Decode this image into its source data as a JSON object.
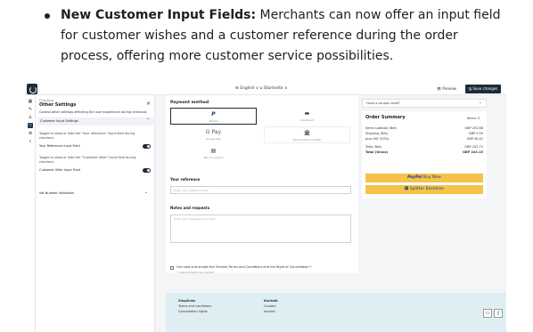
{
  "bullet": {
    "bold": "New Customer Input Fields:",
    "text": " Merchants can now offer an input field for customer wishes and a customer reference during the order process, offering more customer service possibilities."
  },
  "topbar": {
    "language": "⊕ English ∨  ⌂ Startseite ∨",
    "preview": "👁 Preview",
    "save": "🖫 Save changes"
  },
  "sidebar": {
    "small_label": "Checkout",
    "title": "Other Settings",
    "description": "Control other settings affecting the user experience during checkout.",
    "accordion_label": "Customer Input Settings",
    "toggle1_desc": "Toggle to show or hide the \"Your reference\" input field during checkout.",
    "toggle1_label": "Your Reference Input Field",
    "toggle2_desc": "Toggle to show or hide the \"Customer Wish\" input field during checkout.",
    "toggle2_label": "Customer Wish Input Field",
    "vat_label": "Vat Number Validation"
  },
  "form": {
    "payment_title": "Payment method",
    "methods": [
      {
        "name": "PayPal",
        "label": "Paypal"
      },
      {
        "name": "Card",
        "label": "Creditcard"
      },
      {
        "name": "G Pay",
        "label": "Google Pay"
      },
      {
        "name": "Bank",
        "label": "Special bank transfer"
      },
      {
        "name": "Invoice",
        "label": "Pay on invoice"
      }
    ],
    "reference_label": "Your reference",
    "reference_placeholder": "Enter your reference here",
    "notes_label": "Notes and requests",
    "notes_placeholder": "Enter your message to us here",
    "terms_text": "I've read and accept the General Terms and Conditions and the Right of Cancellation *",
    "required_note": "* required fields are marked"
  },
  "summary": {
    "coupon": "Have a coupon code?",
    "title": "Order Summary",
    "items": "Items: 0",
    "rows": [
      {
        "label": "Items subtotal (Net)",
        "value": "GBP 202.68",
        "bold": false
      },
      {
        "label": "Shipping (Net)",
        "value": "GBP 0.00",
        "bold": false
      },
      {
        "label": "plus VAT (20%)",
        "value": "GBP 40.42",
        "bold": false
      },
      {
        "label": "Total (Net)",
        "value": "GBP 202.73",
        "bold": false
      },
      {
        "label": "Total (Gross)",
        "value": "GBP 243.15",
        "bold": true
      }
    ],
    "paypal_brand": "PayPal",
    "paypal_text": " Buy Now",
    "splitter": "🅟 Splitter Bezahlen"
  },
  "footer": {
    "col1_title": "Shoplinks",
    "col1_items": [
      "Terms and conditions",
      "Cancellation rights"
    ],
    "col2_title": "Kontakt",
    "col2_items": [
      "Contact",
      "Imprint"
    ]
  },
  "colors": {
    "primary": "#1e2b3a",
    "accent": "#f5c34a",
    "footer": "#dfeef2"
  }
}
